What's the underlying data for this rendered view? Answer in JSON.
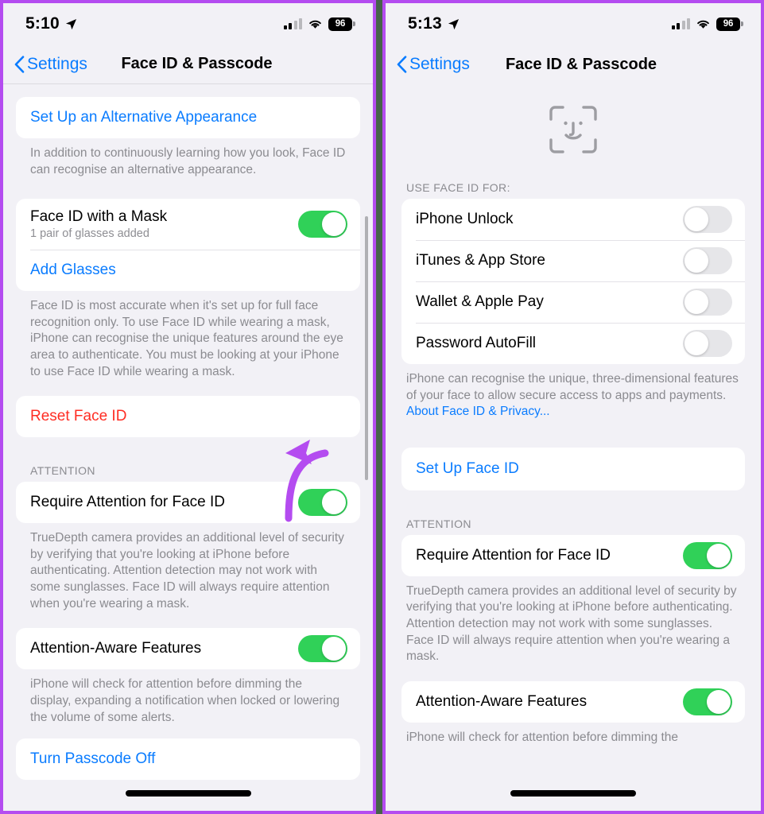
{
  "theme": {
    "accent_blue": "#0a7cff",
    "destructive_red": "#ff2d23",
    "toggle_on_green": "#30d158",
    "annotation_purple": "#b44cf0",
    "page_background": "#f2f1f6"
  },
  "left_phone": {
    "status_bar": {
      "time": "5:10",
      "location_icon": "location-arrow-icon",
      "signal_icon": "cellular-signal-icon",
      "wifi_icon": "wifi-icon",
      "battery_level": "96"
    },
    "nav": {
      "back_icon": "chevron-left-icon",
      "back_label": "Settings",
      "title": "Face ID & Passcode"
    },
    "alternative_appearance": {
      "action_label": "Set Up an Alternative Appearance",
      "footnote": "In addition to continuously learning how you look, Face ID can recognise an alternative appearance."
    },
    "mask_section": {
      "mask_row_title": "Face ID with a Mask",
      "mask_row_subtitle": "1 pair of glasses added",
      "mask_toggle_state": "on",
      "add_glasses_label": "Add Glasses",
      "footnote": "Face ID is most accurate when it's set up for full face recognition only. To use Face ID while wearing a mask, iPhone can recognise the unique features around the eye area to authenticate. You must be looking at your iPhone to use Face ID while wearing a mask."
    },
    "reset": {
      "label": "Reset Face ID"
    },
    "attention": {
      "header": "ATTENTION",
      "require_attention_title": "Require Attention for Face ID",
      "require_attention_state": "on",
      "require_attention_footnote": "TrueDepth camera provides an additional level of security by verifying that you're looking at iPhone before authenticating. Attention detection may not work with some sunglasses. Face ID will always require attention when you're wearing a mask.",
      "attention_aware_title": "Attention-Aware Features",
      "attention_aware_state": "on",
      "attention_aware_footnote": "iPhone will check for attention before dimming the display, expanding a notification when locked or lowering the volume of some alerts."
    },
    "partial_bottom_row": {
      "label": "Turn Passcode Off"
    },
    "annotation": {
      "arrow_icon": "curved-arrow-left-icon",
      "points_at": "Reset Face ID"
    }
  },
  "right_phone": {
    "status_bar": {
      "time": "5:13",
      "location_icon": "location-arrow-icon",
      "signal_icon": "cellular-signal-icon",
      "wifi_icon": "wifi-icon",
      "battery_level": "96"
    },
    "nav": {
      "back_icon": "chevron-left-icon",
      "back_label": "Settings",
      "title": "Face ID & Passcode"
    },
    "hero_icon": "face-id-icon",
    "use_face_id": {
      "header": "USE FACE ID FOR:",
      "rows": [
        {
          "label": "iPhone Unlock",
          "state": "off"
        },
        {
          "label": "iTunes & App Store",
          "state": "off"
        },
        {
          "label": "Wallet & Apple Pay",
          "state": "off"
        },
        {
          "label": "Password AutoFill",
          "state": "off"
        }
      ],
      "footnote_text": "iPhone can recognise the unique, three-dimensional features of your face to allow secure access to apps and payments. ",
      "footnote_link": "About Face ID & Privacy..."
    },
    "setup": {
      "label": "Set Up Face ID"
    },
    "attention": {
      "header": "ATTENTION",
      "require_attention_title": "Require Attention for Face ID",
      "require_attention_state": "on",
      "require_attention_footnote": "TrueDepth camera provides an additional level of security by verifying that you're looking at iPhone before authenticating. Attention detection may not work with some sunglasses. Face ID will always require attention when you're wearing a mask.",
      "attention_aware_title": "Attention-Aware Features",
      "attention_aware_state": "on",
      "attention_aware_partial_footnote": "iPhone will check for attention before dimming the"
    },
    "annotation": {
      "arrow_icon": "curved-arrow-left-icon",
      "points_at": "Set Up Face ID"
    }
  }
}
